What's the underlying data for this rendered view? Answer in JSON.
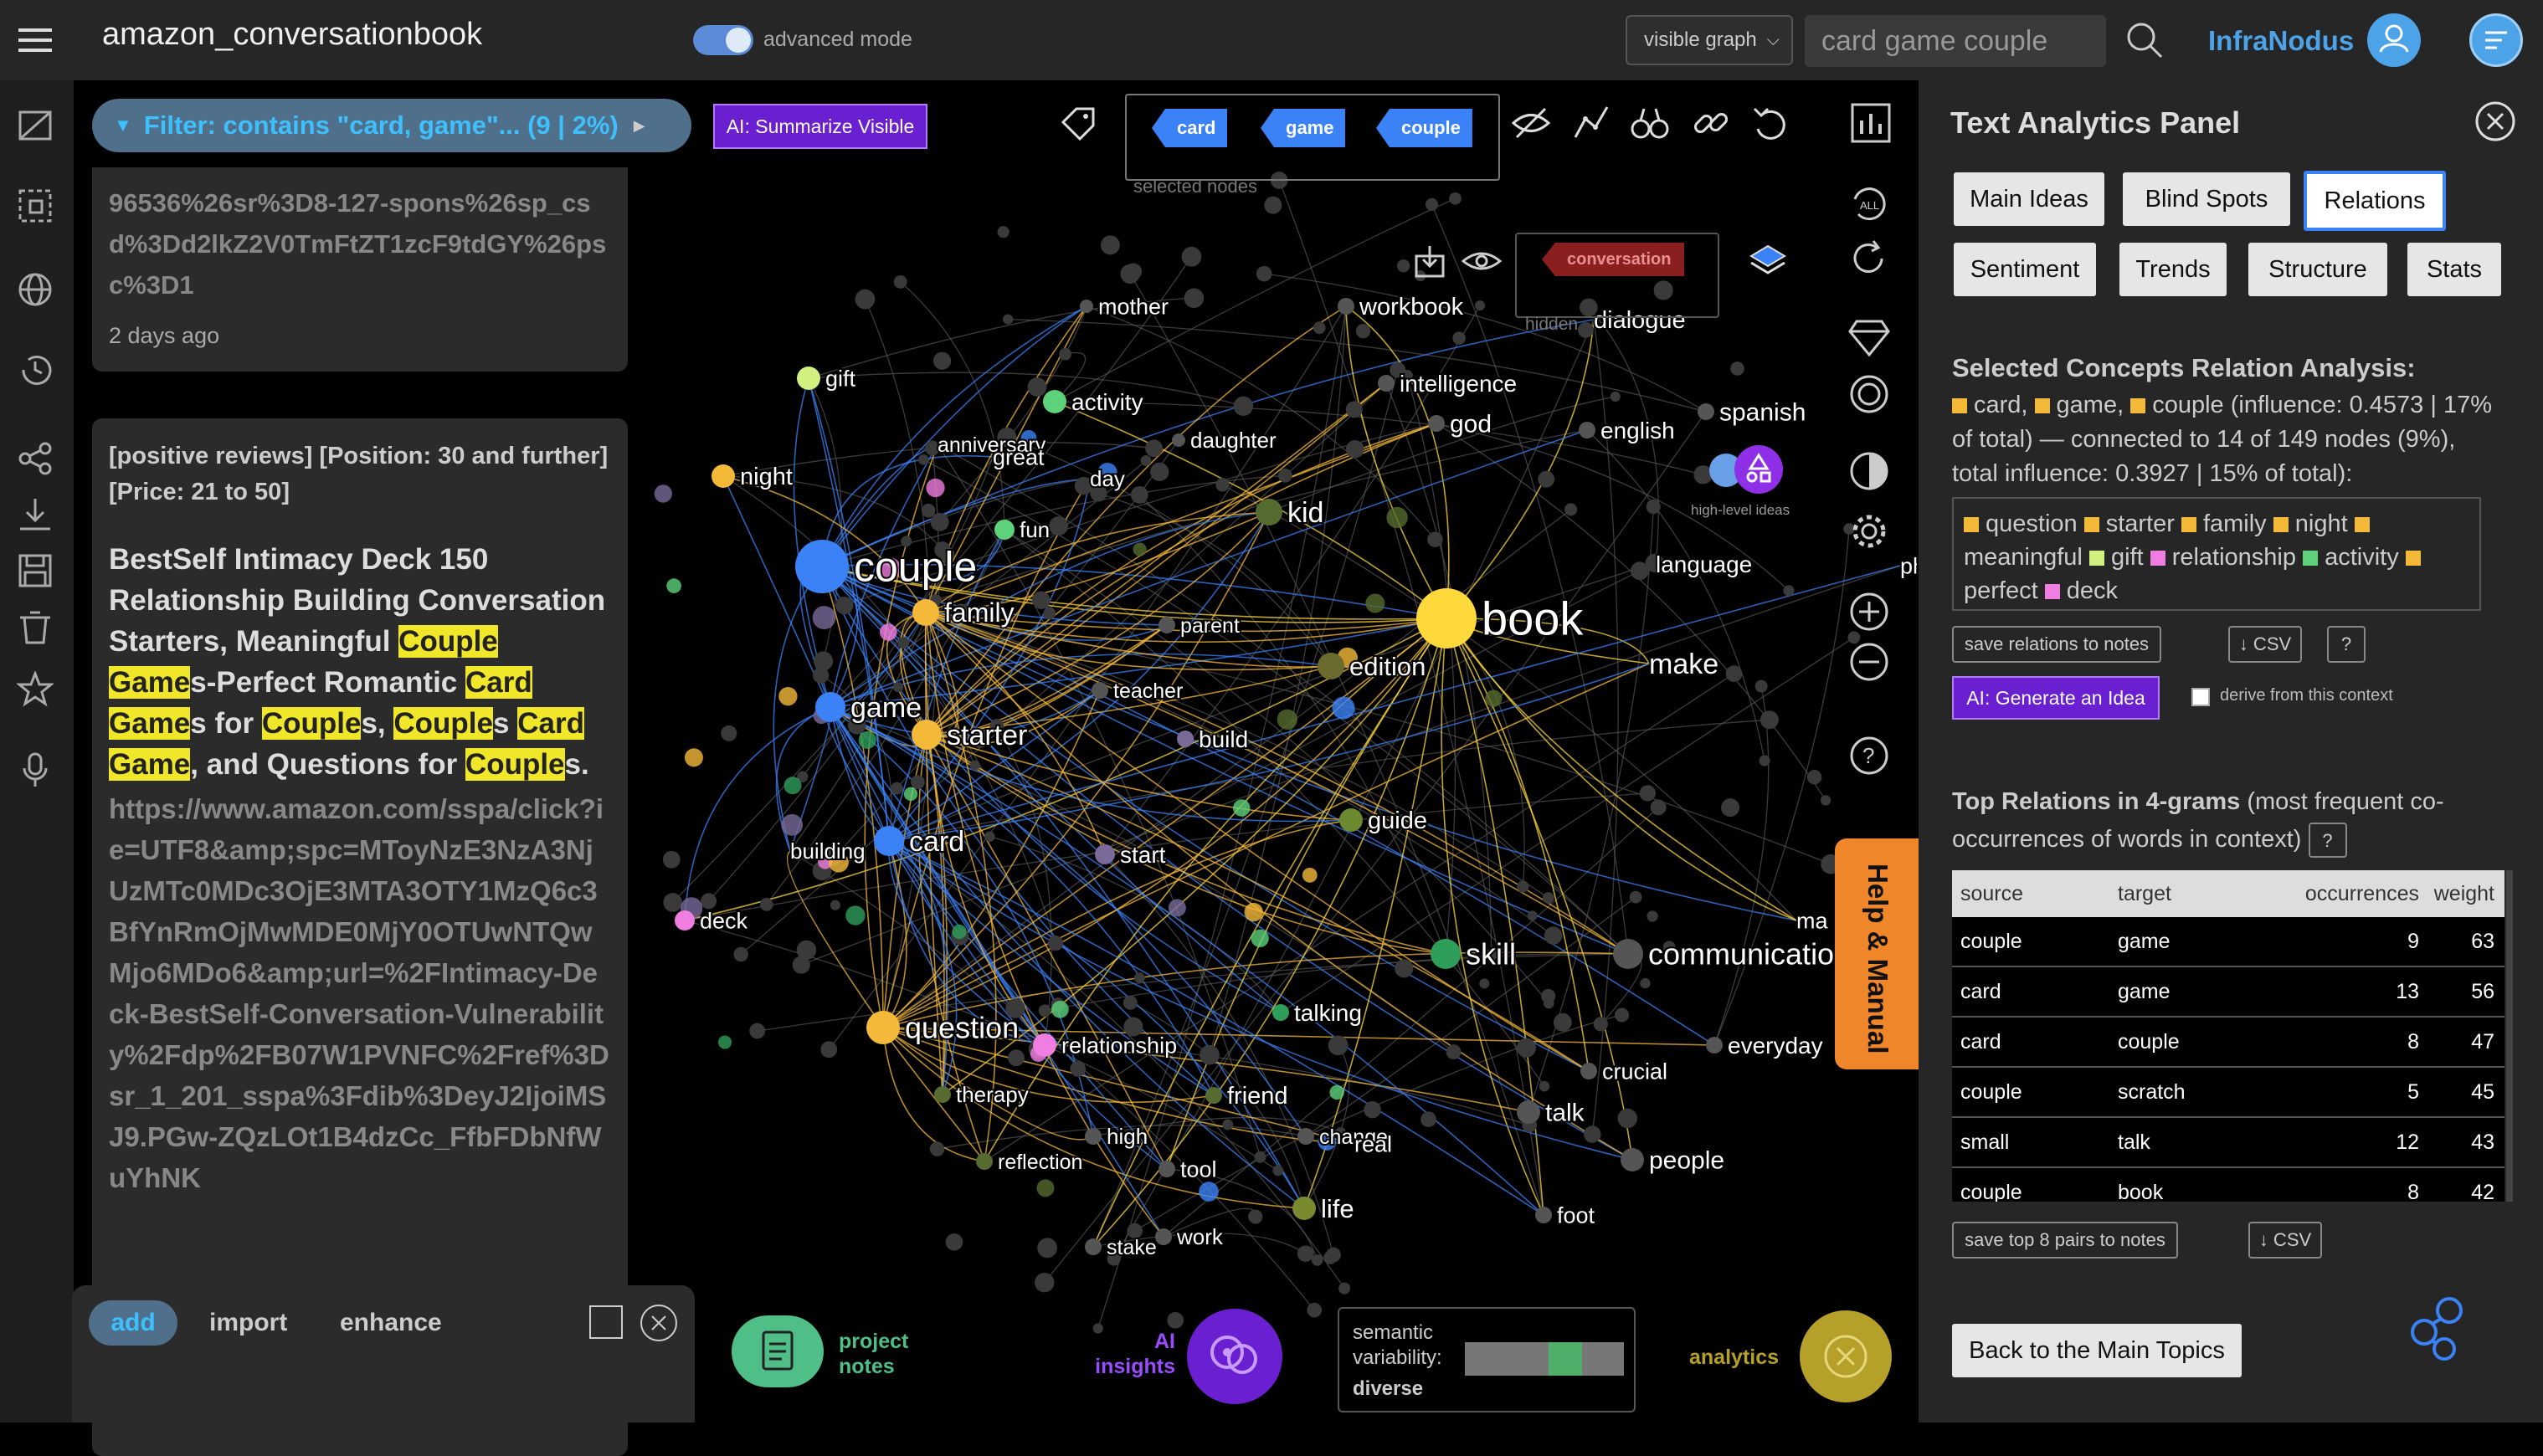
{
  "app": {
    "title": "amazon_conversationbook",
    "advanced_mode_label": "advanced mode",
    "view_select": "visible graph",
    "search_value": "card game couple",
    "brand": "InfraNodus"
  },
  "filter": {
    "label": "Filter: contains \"card, game\"... (9 | 2%)",
    "ai_summarize": "AI: Summarize Visible"
  },
  "left": {
    "card1_text": "96536%26sr%3D8-127-spons%26sp_csd%3Dd2lkZ2V0TmFtZT1zcF9tdGY%26psc%3D1",
    "card1_time": "2 days ago",
    "card2_meta": "[positive reviews] [Position: 30 and further] [Price: 21 to 50]",
    "card2_title_parts": [
      "BestSelf Intimacy Deck 150 Relationship Building Conversation Starters, Meaningful ",
      "Couple",
      " ",
      "Game",
      "s-Perfect Romantic ",
      "Card",
      " ",
      "Game",
      "s for ",
      "Couple",
      "s, ",
      "Couple",
      "s ",
      "Card",
      " ",
      "Game",
      ", and Questions for ",
      "Couple",
      "s."
    ],
    "card2_url": "https://www.amazon.com/sspa/click?ie=UTF8&amp;spc=MToyNzE3NzA3NjUzMTc0MDc3OjE3MTA3OTY1MzQ6c3BfYnRmOjMwMDE0MjY0OTUwNTQwMjo6MDo6&amp;url=%2FIntimacy-Deck-BestSelf-Conversation-Vulnerability%2Fdp%2FB07W1PVNFC%2Fref%3Dsr_1_201_sspa%3Fdib%3DeyJ2IjoiMSJ9.PGw-ZQzLOt1B4dzCc_FfbFDbNfWuYhNK",
    "tabs": [
      "add",
      "import",
      "enhance"
    ]
  },
  "graph": {
    "selected_nodes": [
      "card",
      "game",
      "couple"
    ],
    "selected_nodes_caption": "selected nodes",
    "hidden_tag": "conversation",
    "hidden_caption": "hidden",
    "high_level_caption": "high-level ideas",
    "help_label": "Help & Manual",
    "project_notes": "project notes",
    "ai_insights": "AI insights",
    "semantic_label": "semantic variability:",
    "semantic_value": "diverse",
    "analytics_label": "analytics",
    "labels": [
      {
        "t": "couple",
        "c": "#3b82f6",
        "big": 2
      },
      {
        "t": "book",
        "c": "#ffd93b",
        "big": 3
      },
      {
        "t": "question",
        "c": "#f5b93a",
        "big": 1
      },
      {
        "t": "starter",
        "c": "#f5b93a",
        "big": 1
      },
      {
        "t": "card",
        "c": "#3b82f6",
        "big": 1
      },
      {
        "t": "game",
        "c": "#3b82f6",
        "big": 1
      },
      {
        "t": "family",
        "c": "#f5b93a",
        "big": 1
      },
      {
        "t": "skill",
        "c": "#2f9e5b",
        "big": 1
      },
      {
        "t": "communication",
        "c": "#555",
        "big": 1
      },
      {
        "t": "kid",
        "c": "#556b2f",
        "big": 1
      },
      {
        "t": "edition",
        "c": "#6b6b2f",
        "big": 1
      },
      {
        "t": "make",
        "c": "#555",
        "big": 1
      },
      {
        "t": "workbook",
        "c": "#555",
        "big": 0
      },
      {
        "t": "dialogue",
        "c": "#555",
        "big": 0
      },
      {
        "t": "intelligence",
        "c": "#555",
        "big": 0
      },
      {
        "t": "god",
        "c": "#555",
        "big": 0
      },
      {
        "t": "english",
        "c": "#555",
        "big": 0
      },
      {
        "t": "spanish",
        "c": "#555",
        "big": 0
      },
      {
        "t": "mother",
        "c": "#555",
        "big": 0
      },
      {
        "t": "gift",
        "c": "#d0f080",
        "big": 0
      },
      {
        "t": "activity",
        "c": "#5dd27a",
        "big": 0
      },
      {
        "t": "daughter",
        "c": "#555",
        "big": 0
      },
      {
        "t": "anniversary",
        "c": "#555",
        "big": 0
      },
      {
        "t": "great",
        "c": "#555",
        "big": 0
      },
      {
        "t": "night",
        "c": "#f5b93a",
        "big": 0
      },
      {
        "t": "day",
        "c": "#555",
        "big": 0
      },
      {
        "t": "fun",
        "c": "#5dd27a",
        "big": 0
      },
      {
        "t": "parent",
        "c": "#555",
        "big": 0
      },
      {
        "t": "language",
        "c": "#555",
        "big": 0
      },
      {
        "t": "teacher",
        "c": "#555",
        "big": 0
      },
      {
        "t": "build",
        "c": "#7a6a9a",
        "big": 0
      },
      {
        "t": "guide",
        "c": "#6b8a2f",
        "big": 0
      },
      {
        "t": "building",
        "c": "#555",
        "big": 0
      },
      {
        "t": "start",
        "c": "#7a6a9a",
        "big": 0
      },
      {
        "t": "deck",
        "c": "#f07de0",
        "big": 0
      },
      {
        "t": "relationship",
        "c": "#f07de0",
        "big": 0
      },
      {
        "t": "talking",
        "c": "#2f9e5b",
        "big": 0
      },
      {
        "t": "friend",
        "c": "#556b2f",
        "big": 0
      },
      {
        "t": "therapy",
        "c": "#556b2f",
        "big": 0
      },
      {
        "t": "high",
        "c": "#555",
        "big": 0
      },
      {
        "t": "reflection",
        "c": "#556b2f",
        "big": 0
      },
      {
        "t": "tool",
        "c": "#555",
        "big": 0
      },
      {
        "t": "change",
        "c": "#555",
        "big": 0
      },
      {
        "t": "real",
        "c": "#555",
        "big": 0
      },
      {
        "t": "life",
        "c": "#7a8a2f",
        "big": 0
      },
      {
        "t": "stake",
        "c": "#555",
        "big": 0
      },
      {
        "t": "work",
        "c": "#555",
        "big": 0
      },
      {
        "t": "foot",
        "c": "#555",
        "big": 0
      },
      {
        "t": "talk",
        "c": "#555",
        "big": 0
      },
      {
        "t": "people",
        "c": "#555",
        "big": 0
      },
      {
        "t": "crucial",
        "c": "#555",
        "big": 0
      },
      {
        "t": "everyday",
        "c": "#555",
        "big": 0
      },
      {
        "t": "phr",
        "c": "#555",
        "big": 0
      },
      {
        "t": "ma",
        "c": "#555",
        "big": 0
      }
    ]
  },
  "panel": {
    "title": "Text Analytics Panel",
    "tabs": [
      "Main Ideas",
      "Blind Spots",
      "Relations",
      "Sentiment",
      "Trends",
      "Structure",
      "Stats"
    ],
    "active_tab": "Relations",
    "selected_heading": "Selected Concepts Relation Analysis:",
    "selected_words": [
      "card,",
      "game,",
      "couple"
    ],
    "selected_rest": "(influence: 0.4573 | 17% of total) — connected to 14 of 149 nodes (9%), total influence: 0.3927 | 15% of total):",
    "connected": [
      {
        "w": "question",
        "c": "#f5b93a"
      },
      {
        "w": "starter",
        "c": "#f5b93a"
      },
      {
        "w": "family",
        "c": "#f5b93a"
      },
      {
        "w": "night",
        "c": "#f5b93a"
      },
      {
        "w": "meaningful",
        "c": "#f5b93a"
      },
      {
        "w": "gift",
        "c": "#d0f080"
      },
      {
        "w": "relationship",
        "c": "#f07de0"
      },
      {
        "w": "activity",
        "c": "#5dd27a"
      },
      {
        "w": "perfect",
        "c": "#f5b93a"
      },
      {
        "w": "deck",
        "c": "#f07de0"
      }
    ],
    "save_relations": "save relations to notes",
    "csv": "↓ CSV",
    "help_q": "?",
    "generate": "AI: Generate an Idea",
    "derive": "derive from this context",
    "top_title": "Top Relations in 4-grams",
    "top_sub": " (most frequent co-occurrences of words in context)",
    "table_headers": [
      "source",
      "target",
      "occurrences",
      "weight"
    ],
    "table_rows": [
      [
        "couple",
        "game",
        "9",
        "63"
      ],
      [
        "card",
        "game",
        "13",
        "56"
      ],
      [
        "card",
        "couple",
        "8",
        "47"
      ],
      [
        "couple",
        "scratch",
        "5",
        "45"
      ],
      [
        "small",
        "talk",
        "12",
        "43"
      ],
      [
        "couple",
        "book",
        "8",
        "42"
      ]
    ],
    "save_top": "save top 8 pairs to notes",
    "back": "Back to the Main Topics"
  }
}
